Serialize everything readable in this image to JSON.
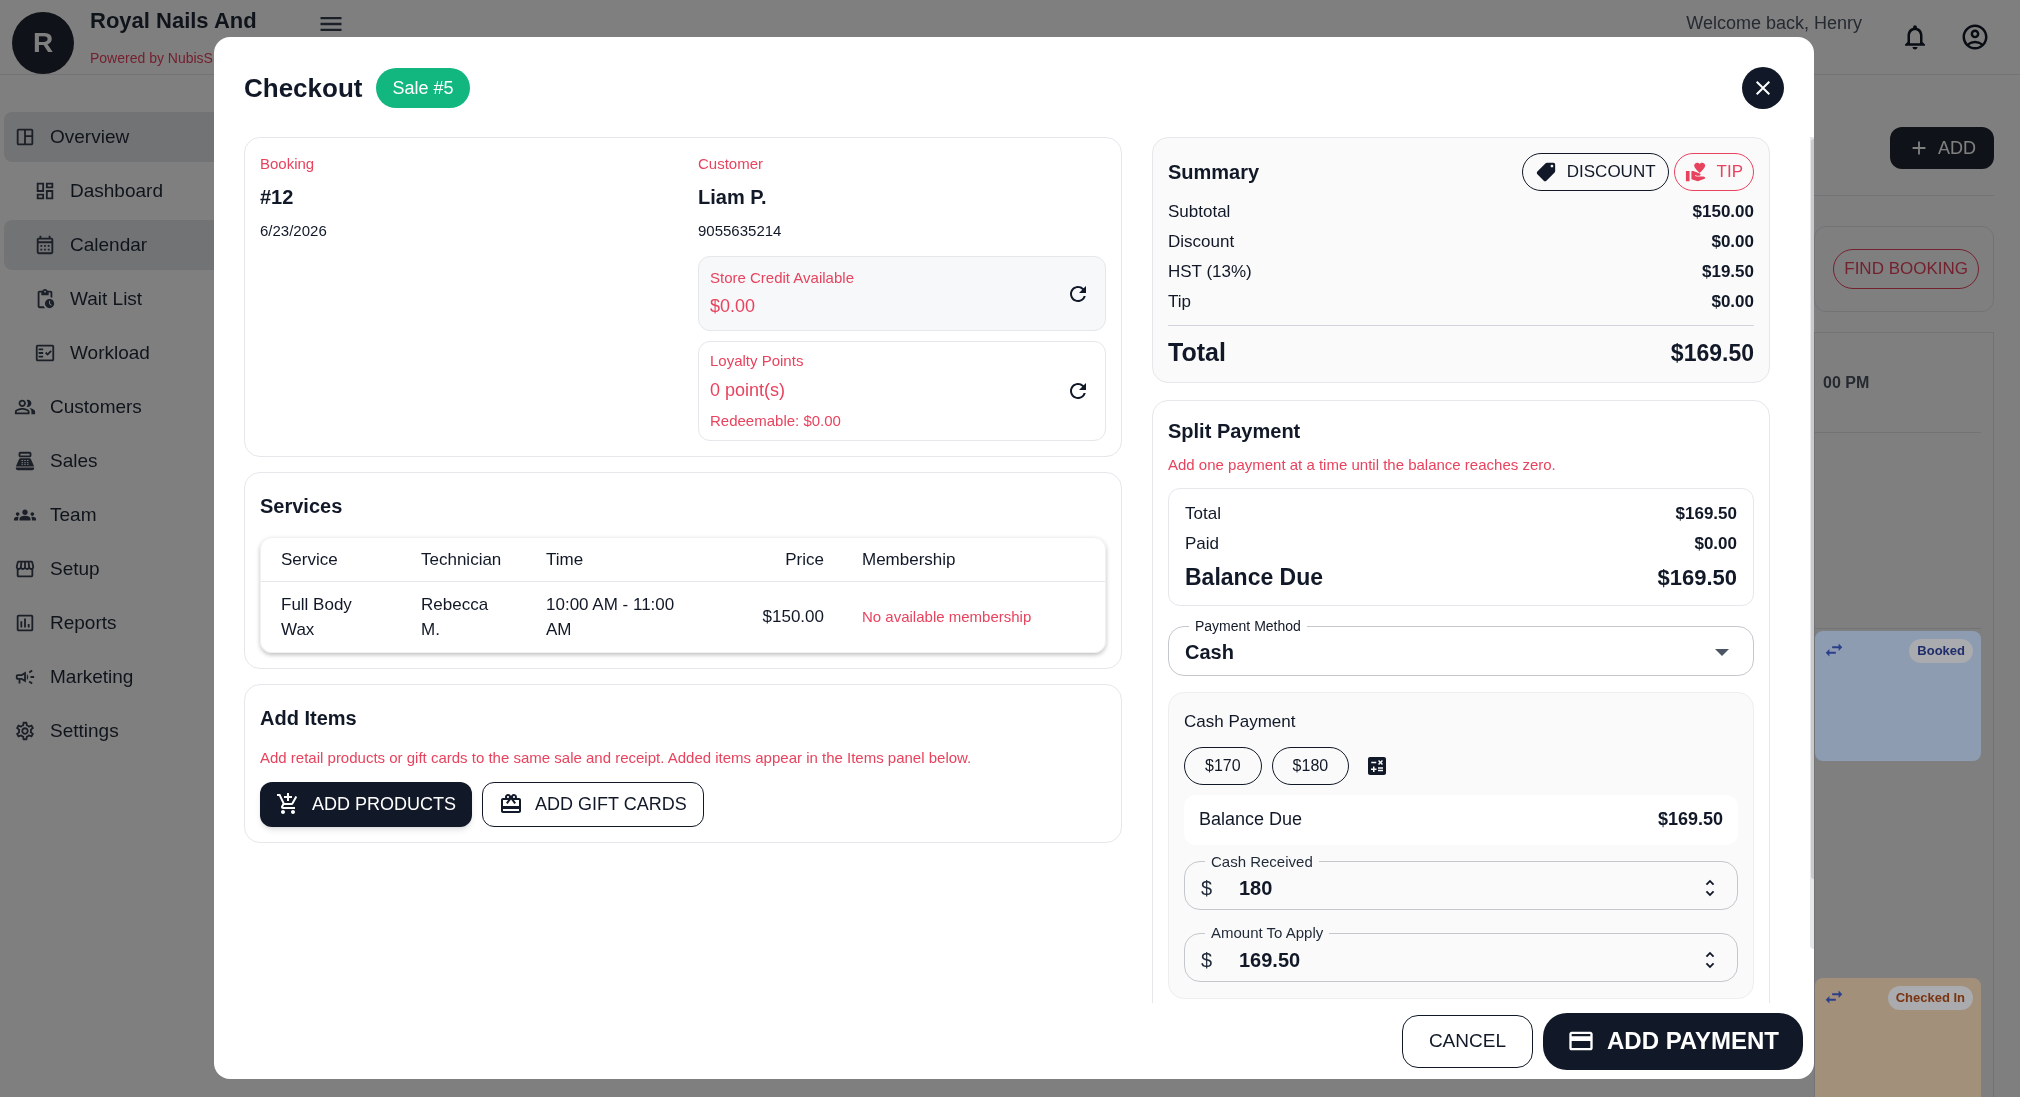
{
  "app": {
    "avatar_letter": "R",
    "brand": "Royal Nails And",
    "powered_by": "Powered by NubisS",
    "welcome": "Welcome back, Henry"
  },
  "sidebar": {
    "items": [
      {
        "label": "Overview",
        "selected": true,
        "children": [
          {
            "label": "Dashboard",
            "selected": false
          },
          {
            "label": "Calendar",
            "selected": true
          },
          {
            "label": "Wait List",
            "selected": false
          },
          {
            "label": "Workload",
            "selected": false
          }
        ]
      },
      {
        "label": "Customers",
        "selected": false
      },
      {
        "label": "Sales",
        "selected": false
      },
      {
        "label": "Team",
        "selected": false
      },
      {
        "label": "Setup",
        "selected": false
      },
      {
        "label": "Reports",
        "selected": false
      },
      {
        "label": "Marketing",
        "selected": false
      },
      {
        "label": "Settings",
        "selected": false
      }
    ]
  },
  "background": {
    "add_button": "ADD",
    "find_booking_button": "FIND BOOKING",
    "time_label": "00 PM",
    "appointments": [
      {
        "status": "Booked",
        "color": "#8e9cb2"
      },
      {
        "status": "Checked In",
        "color": "#a3907a"
      }
    ]
  },
  "checkout": {
    "title": "Checkout",
    "sale_badge": "Sale #5",
    "booking": {
      "label": "Booking",
      "number": "#12",
      "date": "6/23/2026"
    },
    "customer": {
      "label": "Customer",
      "name": "Liam P.",
      "phone": "9055635214"
    },
    "store_credit": {
      "label": "Store Credit Available",
      "value": "$0.00"
    },
    "loyalty": {
      "label": "Loyalty Points",
      "value": "0 point(s)",
      "redeemable": "Redeemable: $0.00"
    },
    "services": {
      "title": "Services",
      "columns": [
        "Service",
        "Technician",
        "Time",
        "Price",
        "Membership"
      ],
      "rows": [
        {
          "service": "Full Body Wax",
          "technician": "Rebecca M.",
          "time": "10:00 AM - 11:00 AM",
          "price": "$150.00",
          "membership": "No available membership"
        }
      ]
    },
    "add_items": {
      "title": "Add Items",
      "note": "Add retail products or gift cards to the same sale and receipt. Added items appear in the Items panel below.",
      "products_button": "ADD PRODUCTS",
      "gift_cards_button": "ADD GIFT CARDS"
    },
    "summary": {
      "title": "Summary",
      "discount_button": "DISCOUNT",
      "tip_button": "TIP",
      "lines": [
        {
          "label": "Subtotal",
          "value": "$150.00"
        },
        {
          "label": "Discount",
          "value": "$0.00"
        },
        {
          "label": "HST (13%)",
          "value": "$19.50"
        },
        {
          "label": "Tip",
          "value": "$0.00"
        }
      ],
      "total_label": "Total",
      "total_value": "$169.50"
    },
    "split_payment": {
      "title": "Split Payment",
      "note": "Add one payment at a time until the balance reaches zero.",
      "lines": [
        {
          "label": "Total",
          "value": "$169.50"
        },
        {
          "label": "Paid",
          "value": "$0.00"
        }
      ],
      "balance_label": "Balance Due",
      "balance_value": "$169.50",
      "payment_method": {
        "label": "Payment Method",
        "value": "Cash"
      },
      "cash_payment": {
        "title": "Cash Payment",
        "quick_amounts": [
          "$170",
          "$180"
        ],
        "balance_label": "Balance Due",
        "balance_value": "$169.50",
        "fields": [
          {
            "label": "Cash Received",
            "prefix": "$",
            "value": "180"
          },
          {
            "label": "Amount To Apply",
            "prefix": "$",
            "value": "169.50"
          }
        ]
      }
    },
    "footer": {
      "cancel_button": "CANCEL",
      "add_payment_button": "ADD PAYMENT"
    }
  }
}
